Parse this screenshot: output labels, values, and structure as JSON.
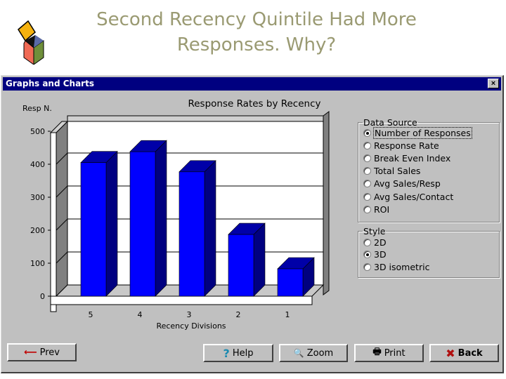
{
  "slide": {
    "title_line1": "Second Recency Quintile Had More",
    "title_line2": "Responses. Why?",
    "logo_icon": "open-box-logo-icon"
  },
  "window": {
    "title": "Graphs and Charts",
    "close_label": "×",
    "close_icon": "close-icon"
  },
  "chart_data": {
    "type": "bar",
    "style": "3D",
    "title": "Response Rates by Recency",
    "ylabel": "Resp N.",
    "xlabel": "Recency Divisions",
    "categories": [
      "5",
      "4",
      "3",
      "2",
      "1"
    ],
    "values": [
      405,
      438,
      377,
      187,
      83
    ],
    "ylim": [
      0,
      500
    ],
    "yticks": [
      0,
      100,
      200,
      300,
      400,
      500
    ],
    "grid": true,
    "bar_color": "#0000ff",
    "bar_side_color": "#000080"
  },
  "data_source": {
    "legend": "Data Source",
    "options": [
      {
        "label": "Number of Responses",
        "checked": true
      },
      {
        "label": "Response Rate",
        "checked": false
      },
      {
        "label": "Break Even Index",
        "checked": false
      },
      {
        "label": "Total Sales",
        "checked": false
      },
      {
        "label": "Avg Sales/Resp",
        "checked": false
      },
      {
        "label": "Avg Sales/Contact",
        "checked": false
      },
      {
        "label": "ROI",
        "checked": false
      }
    ]
  },
  "style": {
    "legend": "Style",
    "options": [
      {
        "label": "2D",
        "checked": false
      },
      {
        "label": "3D",
        "checked": true
      },
      {
        "label": "3D isometric",
        "checked": false
      }
    ]
  },
  "buttons": {
    "prev": {
      "label": "Prev",
      "icon": "arrow-left-icon",
      "glyph": "⟵"
    },
    "help": {
      "label": "Help",
      "icon": "question-icon",
      "glyph": "?"
    },
    "zoom": {
      "label": "Zoom",
      "icon": "magnifier-icon",
      "glyph": "🔍"
    },
    "print": {
      "label": "Print",
      "icon": "printer-icon",
      "glyph": "🖶"
    },
    "back": {
      "label": "Back",
      "icon": "x-mark-icon",
      "glyph": "✖"
    }
  }
}
